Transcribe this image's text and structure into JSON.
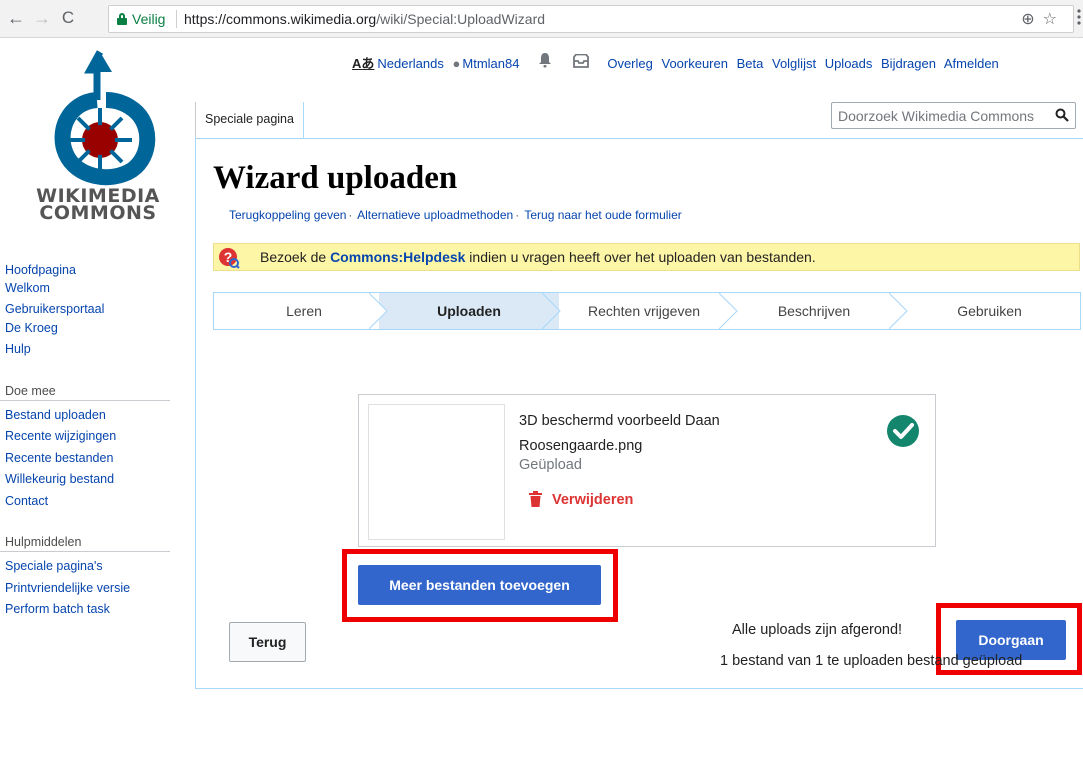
{
  "browser": {
    "secure_label": "Veilig",
    "url_host": "https://commons.wikimedia.org",
    "url_path": "/wiki/Special:UploadWizard"
  },
  "personal": {
    "language": "Nederlands",
    "username": "Mtmlan84",
    "links": [
      "Overleg",
      "Voorkeuren",
      "Beta",
      "Volglijst",
      "Uploads",
      "Bijdragen",
      "Afmelden"
    ]
  },
  "logo": {
    "line1": "WIKIMEDIA",
    "line2": "COMMONS"
  },
  "sidebar": {
    "nav": [
      "Hoofdpagina",
      "Welkom",
      "Gebruikersportaal",
      "De Kroeg",
      "Hulp"
    ],
    "participate_heading": "Doe mee",
    "participate": [
      "Bestand uploaden",
      "Recente wijzigingen",
      "Recente bestanden",
      "Willekeurig bestand",
      "Contact"
    ],
    "tools_heading": "Hulpmiddelen",
    "tools": [
      "Speciale pagina's",
      "Printvriendelijke versie",
      "Perform batch task"
    ]
  },
  "tab": {
    "label": "Speciale pagina"
  },
  "search": {
    "placeholder": "Doorzoek Wikimedia Commons"
  },
  "page": {
    "title": "Wizard uploaden",
    "help_links": [
      "Terugkoppeling geven",
      "Alternatieve uploadmethoden",
      "Terug naar het oude formulier"
    ],
    "notice_pre": "Bezoek de ",
    "notice_link": "Commons:Helpdesk",
    "notice_post": " indien u vragen heeft over het uploaden van bestanden."
  },
  "steps": [
    "Leren",
    "Uploaden",
    "Rechten vrijgeven",
    "Beschrijven",
    "Gebruiken"
  ],
  "steps_active_index": 1,
  "upload": {
    "filename_line1": "3D beschermd voorbeeld Daan",
    "filename_line2": "Roosengaarde.png",
    "status": "Geüpload",
    "remove_label": "Verwijderen"
  },
  "buttons": {
    "add_more": "Meer bestanden toevoegen",
    "back": "Terug",
    "continue": "Doorgaan"
  },
  "footer": {
    "all_done": "Alle uploads zijn afgerond!",
    "count_text": "1 bestand van 1 te uploaden bestand geüpload"
  },
  "colors": {
    "link": "#0645ad",
    "primary": "#3366cc",
    "highlight": "#ee0000",
    "success": "#14866d",
    "danger": "#dd3333"
  }
}
